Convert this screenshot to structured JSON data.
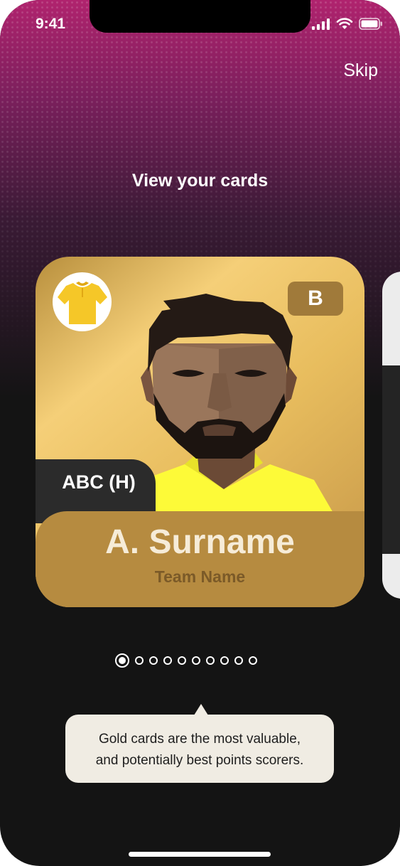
{
  "status_bar": {
    "time": "9:41"
  },
  "header": {
    "skip_label": "Skip",
    "title": "View your cards"
  },
  "card": {
    "tier_color": "#e8bd5e",
    "grade": "B",
    "fixture": "ABC (H)",
    "player_name": "A. Surname",
    "team_name": "Team Name",
    "shirt_icon": "shirt-icon"
  },
  "pagination": {
    "total": 10,
    "active_index": 0
  },
  "tooltip": {
    "line1": "Gold cards are the most valuable,",
    "line2": "and potentially best points scorers."
  }
}
